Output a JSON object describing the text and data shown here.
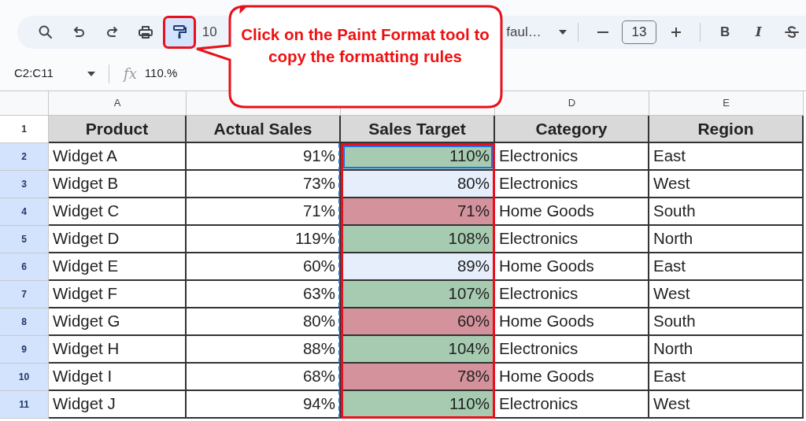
{
  "toolbar": {
    "tools": [
      {
        "kind": "search",
        "selected": false,
        "annotated": false
      },
      {
        "kind": "undo",
        "selected": false,
        "annotated": false
      },
      {
        "kind": "redo",
        "selected": false,
        "annotated": false
      },
      {
        "kind": "print",
        "selected": false,
        "annotated": false
      },
      {
        "kind": "paint-format",
        "selected": true,
        "annotated": true
      }
    ],
    "zoom": "10",
    "font": "faul…",
    "font_size": "13",
    "bold": "B",
    "italic": "I"
  },
  "callout": {
    "text": "Click on the Paint Format tool to copy the formatting rules"
  },
  "formula_bar": {
    "name_box": "C2:C11",
    "fx": "fx",
    "formula": "110.%"
  },
  "column_headers": [
    "A",
    "D",
    "E"
  ],
  "header_row": {
    "number": "1",
    "selected": false,
    "cells": [
      "Product",
      "Actual Sales",
      "Sales Target",
      "Category",
      "Region"
    ]
  },
  "rows": [
    {
      "number": "2",
      "selected": true,
      "product": "Widget A",
      "actual": "91%",
      "target": {
        "text": "110%",
        "color": "#a6cbb1",
        "active": true
      },
      "category": "Electronics",
      "region": "East"
    },
    {
      "number": "3",
      "selected": true,
      "product": "Widget B",
      "actual": "73%",
      "target": {
        "text": "80%",
        "active": false
      },
      "category": "Electronics",
      "region": "West"
    },
    {
      "number": "4",
      "selected": true,
      "product": "Widget C",
      "actual": "71%",
      "target": {
        "text": "71%",
        "color": "#d4929c",
        "active": false
      },
      "category": "Home Goods",
      "region": "South"
    },
    {
      "number": "5",
      "selected": true,
      "product": "Widget D",
      "actual": "119%",
      "target": {
        "text": "108%",
        "color": "#a6cbb1",
        "active": false
      },
      "category": "Electronics",
      "region": "North"
    },
    {
      "number": "6",
      "selected": true,
      "product": "Widget E",
      "actual": "60%",
      "target": {
        "text": "89%",
        "active": false
      },
      "category": "Home Goods",
      "region": "East"
    },
    {
      "number": "7",
      "selected": true,
      "product": "Widget F",
      "actual": "63%",
      "target": {
        "text": "107%",
        "color": "#a6cbb1",
        "active": false
      },
      "category": "Electronics",
      "region": "West"
    },
    {
      "number": "8",
      "selected": true,
      "product": "Widget G",
      "actual": "80%",
      "target": {
        "text": "60%",
        "color": "#d4929c",
        "active": false
      },
      "category": "Home Goods",
      "region": "South"
    },
    {
      "number": "9",
      "selected": true,
      "product": "Widget H",
      "actual": "88%",
      "target": {
        "text": "104%",
        "color": "#a6cbb1",
        "active": false
      },
      "category": "Electronics",
      "region": "North"
    },
    {
      "number": "10",
      "selected": true,
      "product": "Widget I",
      "actual": "68%",
      "target": {
        "text": "78%",
        "color": "#d4929c",
        "active": false
      },
      "category": "Home Goods",
      "region": "East"
    },
    {
      "number": "11",
      "selected": true,
      "product": "Widget J",
      "actual": "94%",
      "target": {
        "text": "110%",
        "color": "#a6cbb1",
        "active": false
      },
      "category": "Electronics",
      "region": "West"
    }
  ]
}
